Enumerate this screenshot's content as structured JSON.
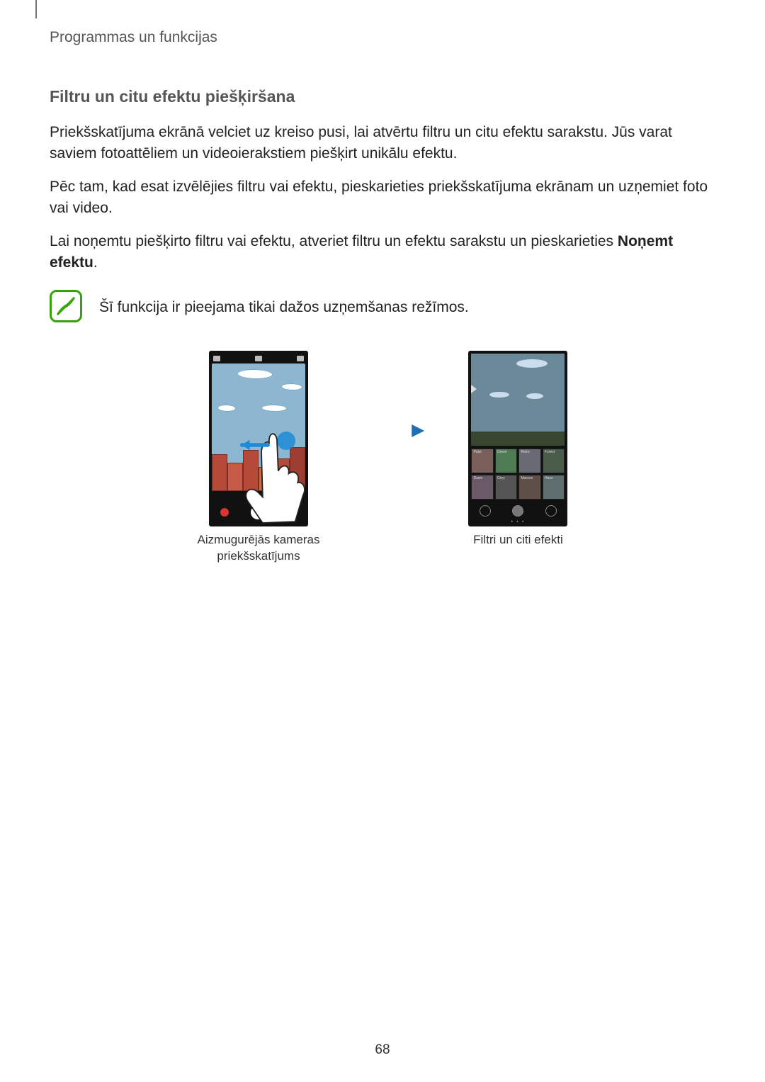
{
  "header": {
    "section_title": "Programmas un funkcijas"
  },
  "subheading": "Filtru un citu efektu piešķiršana",
  "paragraphs": {
    "p1": "Priekšskatījuma ekrānā velciet uz kreiso pusi, lai atvērtu filtru un citu efektu sarakstu. Jūs varat saviem fotoattēliem un videoierakstiem piešķirt unikālu efektu.",
    "p2": "Pēc tam, kad esat izvēlējies filtru vai efektu, pieskarieties priekšskatījuma ekrānam un uzņemiet foto vai video.",
    "p3_a": "Lai noņemtu piešķirto filtru vai efektu, atveriet filtru un efektu sarakstu un pieskarieties ",
    "p3_b": "Noņemt efektu",
    "p3_c": "."
  },
  "note": {
    "text": "Šī funkcija ir pieejama tikai dažos uzņemšanas režīmos."
  },
  "figure": {
    "left_caption_line1": "Aizmugurējās kameras",
    "left_caption_line2": "priekšskatījums",
    "right_caption": "Filtri un citi efekti",
    "filter_labels": [
      "Puķe",
      "Green",
      "Retro",
      "Forest",
      "Dawn",
      "Grey",
      "Maroon",
      "Haze"
    ]
  },
  "page_number": "68"
}
